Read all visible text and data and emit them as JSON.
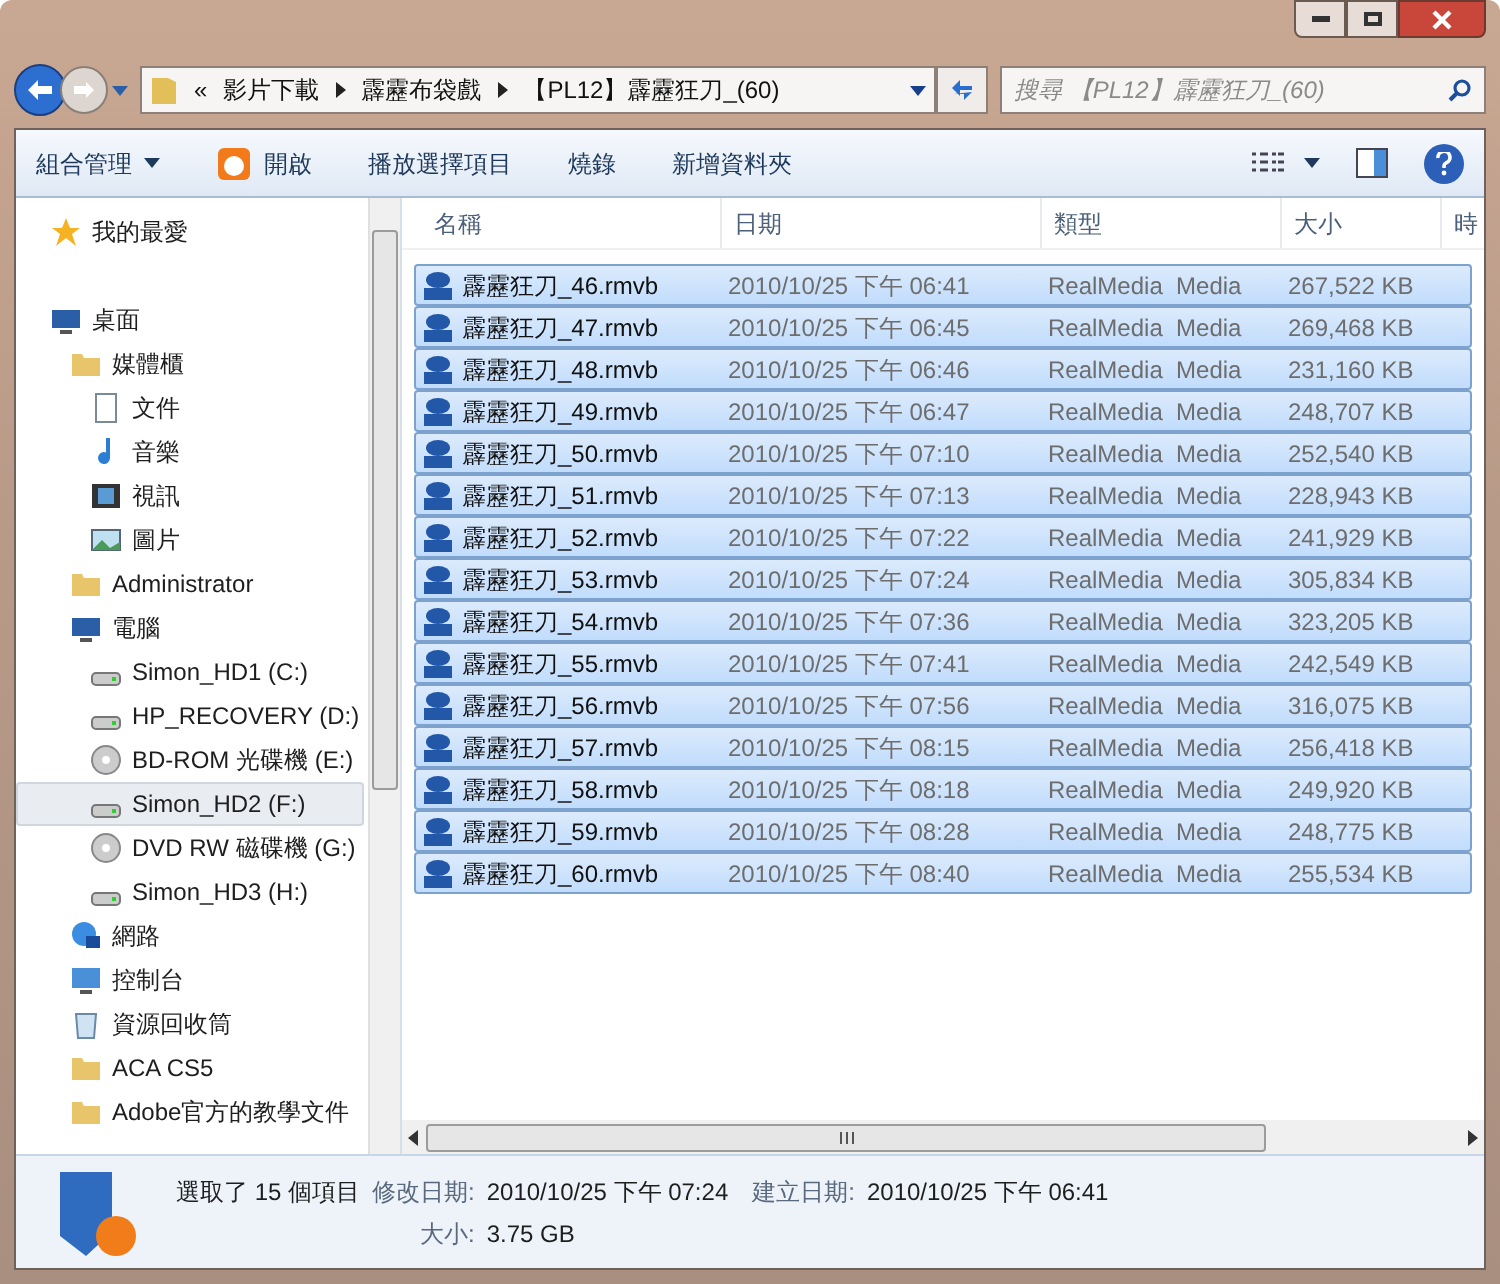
{
  "address": {
    "crumbs": [
      "«",
      "影片下載",
      "霹靂布袋戲",
      "【PL12】霹靂狂刀_(60)"
    ]
  },
  "search": {
    "placeholder": "搜尋 【PL12】霹靂狂刀_(60)"
  },
  "toolbar": [
    {
      "label": "組合管理",
      "kind": "menu"
    },
    {
      "label": "開啟",
      "kind": "open"
    },
    {
      "label": "播放選擇項目",
      "kind": "plain"
    },
    {
      "label": "燒錄",
      "kind": "plain"
    },
    {
      "label": "新增資料夾",
      "kind": "plain"
    }
  ],
  "sidebar": {
    "items": [
      {
        "label": "我的最愛",
        "kind": "star",
        "selected": false
      },
      {
        "label": "桌面",
        "kind": "desktop",
        "selected": false,
        "children": [
          {
            "label": "媒體櫃",
            "kind": "library",
            "selected": false,
            "children": [
              {
                "label": "文件",
                "kind": "doc",
                "selected": false
              },
              {
                "label": "音樂",
                "kind": "music",
                "selected": false
              },
              {
                "label": "視訊",
                "kind": "video",
                "selected": false
              },
              {
                "label": "圖片",
                "kind": "picture",
                "selected": false
              }
            ]
          },
          {
            "label": "Administrator",
            "kind": "user",
            "selected": false
          },
          {
            "label": "電腦",
            "kind": "computer",
            "selected": false,
            "children": [
              {
                "label": "Simon_HD1 (C:)",
                "kind": "sysdrive",
                "selected": false
              },
              {
                "label": "HP_RECOVERY (D:)",
                "kind": "drive",
                "selected": false
              },
              {
                "label": "BD-ROM 光碟機 (E:)",
                "kind": "optical",
                "selected": false
              },
              {
                "label": "Simon_HD2 (F:)",
                "kind": "drive",
                "selected": true
              },
              {
                "label": "DVD RW 磁碟機 (G:)",
                "kind": "dvd",
                "selected": false
              },
              {
                "label": "Simon_HD3 (H:)",
                "kind": "drive",
                "selected": false
              }
            ]
          },
          {
            "label": "網路",
            "kind": "network",
            "selected": false
          },
          {
            "label": "控制台",
            "kind": "control",
            "selected": false
          },
          {
            "label": "資源回收筒",
            "kind": "recycle",
            "selected": false
          },
          {
            "label": "ACA CS5",
            "kind": "folder",
            "selected": false
          },
          {
            "label": "Adobe官方的教學文件",
            "kind": "folder",
            "selected": false
          }
        ]
      }
    ]
  },
  "table": {
    "columns": [
      "名稱",
      "日期",
      "類型",
      "大小",
      "時"
    ],
    "rows": [
      {
        "name": "霹靂狂刀_46.rmvb",
        "date": "2010/10/25 下午 06:41",
        "type": "RealMedia  Media",
        "size": "267,522 KB",
        "selected": true
      },
      {
        "name": "霹靂狂刀_47.rmvb",
        "date": "2010/10/25 下午 06:45",
        "type": "RealMedia  Media",
        "size": "269,468 KB",
        "selected": true
      },
      {
        "name": "霹靂狂刀_48.rmvb",
        "date": "2010/10/25 下午 06:46",
        "type": "RealMedia  Media",
        "size": "231,160 KB",
        "selected": true
      },
      {
        "name": "霹靂狂刀_49.rmvb",
        "date": "2010/10/25 下午 06:47",
        "type": "RealMedia  Media",
        "size": "248,707 KB",
        "selected": true
      },
      {
        "name": "霹靂狂刀_50.rmvb",
        "date": "2010/10/25 下午 07:10",
        "type": "RealMedia  Media",
        "size": "252,540 KB",
        "selected": true
      },
      {
        "name": "霹靂狂刀_51.rmvb",
        "date": "2010/10/25 下午 07:13",
        "type": "RealMedia  Media",
        "size": "228,943 KB",
        "selected": true
      },
      {
        "name": "霹靂狂刀_52.rmvb",
        "date": "2010/10/25 下午 07:22",
        "type": "RealMedia  Media",
        "size": "241,929 KB",
        "selected": true
      },
      {
        "name": "霹靂狂刀_53.rmvb",
        "date": "2010/10/25 下午 07:24",
        "type": "RealMedia  Media",
        "size": "305,834 KB",
        "selected": true
      },
      {
        "name": "霹靂狂刀_54.rmvb",
        "date": "2010/10/25 下午 07:36",
        "type": "RealMedia  Media",
        "size": "323,205 KB",
        "selected": true
      },
      {
        "name": "霹靂狂刀_55.rmvb",
        "date": "2010/10/25 下午 07:41",
        "type": "RealMedia  Media",
        "size": "242,549 KB",
        "selected": true
      },
      {
        "name": "霹靂狂刀_56.rmvb",
        "date": "2010/10/25 下午 07:56",
        "type": "RealMedia  Media",
        "size": "316,075 KB",
        "selected": true
      },
      {
        "name": "霹靂狂刀_57.rmvb",
        "date": "2010/10/25 下午 08:15",
        "type": "RealMedia  Media",
        "size": "256,418 KB",
        "selected": true
      },
      {
        "name": "霹靂狂刀_58.rmvb",
        "date": "2010/10/25 下午 08:18",
        "type": "RealMedia  Media",
        "size": "249,920 KB",
        "selected": true
      },
      {
        "name": "霹靂狂刀_59.rmvb",
        "date": "2010/10/25 下午 08:28",
        "type": "RealMedia  Media",
        "size": "248,775 KB",
        "selected": true
      },
      {
        "name": "霹靂狂刀_60.rmvb",
        "date": "2010/10/25 下午 08:40",
        "type": "RealMedia  Media",
        "size": "255,534 KB",
        "selected": true
      }
    ]
  },
  "status_bar": {
    "summary": "選取了 15 個項目",
    "fields": [
      {
        "label": "修改日期:",
        "value": "2010/10/25 下午 07:24"
      },
      {
        "label": "建立日期:",
        "value": "2010/10/25 下午 06:41"
      },
      {
        "label": "大小:",
        "value": "3.75 GB"
      }
    ]
  }
}
